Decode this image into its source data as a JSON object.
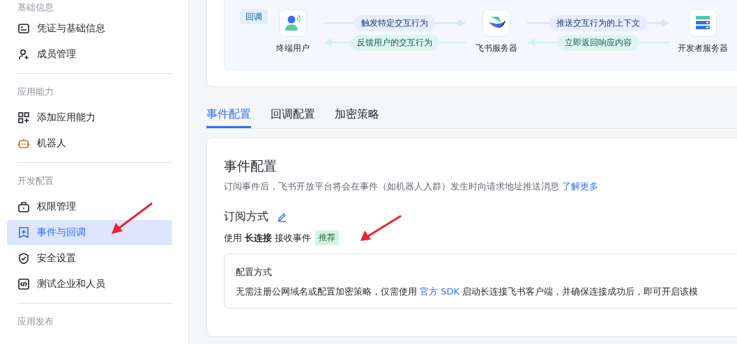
{
  "sidebar": {
    "sections": [
      {
        "title": "基础信息",
        "items": [
          {
            "label": "凭证与基础信息",
            "selected": false
          },
          {
            "label": "成员管理",
            "selected": false
          }
        ]
      },
      {
        "title": "应用能力",
        "items": [
          {
            "label": "添加应用能力",
            "selected": false
          },
          {
            "label": "机器人",
            "selected": false
          }
        ]
      },
      {
        "title": "开发配置",
        "items": [
          {
            "label": "权限管理",
            "selected": false
          },
          {
            "label": "事件与回调",
            "selected": true
          },
          {
            "label": "安全设置",
            "selected": false
          },
          {
            "label": "测试企业和人员",
            "selected": false
          }
        ]
      },
      {
        "title": "应用发布"
      }
    ]
  },
  "flow": {
    "badge": "回调",
    "nodes": [
      {
        "name": "终端用户"
      },
      {
        "name": "飞书服务器"
      },
      {
        "name": "开发者服务器"
      }
    ],
    "links": [
      {
        "arrows": [
          {
            "label": "触发特定交互行为",
            "kind": "forward"
          },
          {
            "label": "反馈用户的交互行为",
            "kind": "backward"
          }
        ]
      },
      {
        "arrows": [
          {
            "label": "推送交互行为的上下文",
            "kind": "forward"
          },
          {
            "label": "立即返回响应内容",
            "kind": "backward"
          }
        ]
      }
    ]
  },
  "tabs": [
    {
      "label": "事件配置",
      "selected": true
    },
    {
      "label": "回调配置",
      "selected": false
    },
    {
      "label": "加密策略",
      "selected": false
    }
  ],
  "panel": {
    "title": "事件配置",
    "description": "订阅事件后，飞书开放平台将会在事件（如机器人入群）发生时向请求地址推送消息",
    "learn_more": "了解更多",
    "subscription": {
      "title": "订阅方式",
      "prefix": "使用",
      "method": "长连接",
      "suffix": "接收事件",
      "tag": "推荐"
    },
    "config": {
      "title": "配置方式",
      "text_before": "无需注册公网域名或配置加密策略，仅需使用",
      "link": "官方 SDK",
      "text_after": "启动长连接飞书客户端，并确保连接成功后，即可开启该模"
    }
  }
}
